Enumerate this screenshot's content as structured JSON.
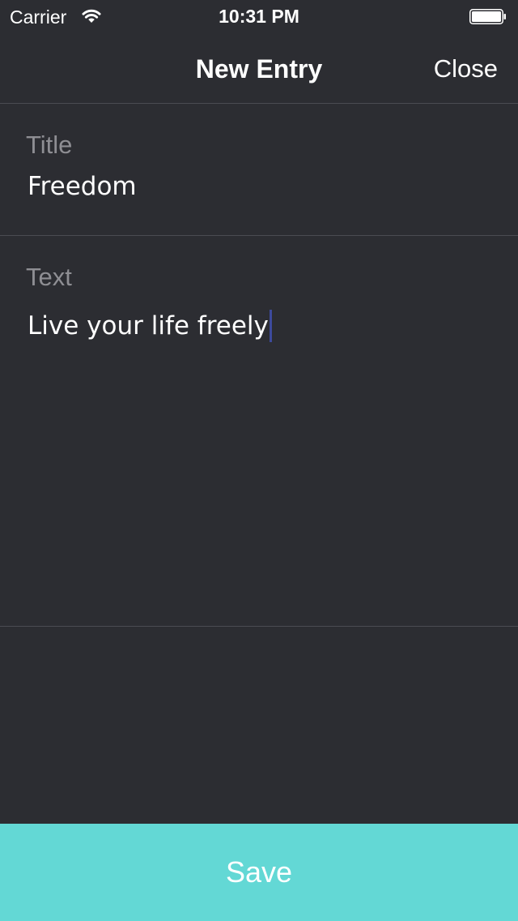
{
  "status_bar": {
    "carrier": "Carrier",
    "time": "10:31 PM",
    "wifi_icon": "wifi-icon",
    "battery_icon": "battery-icon"
  },
  "nav": {
    "title": "New Entry",
    "close_label": "Close"
  },
  "form": {
    "title_label": "Title",
    "title_value": "Freedom",
    "text_label": "Text",
    "text_value": "Live your life freely"
  },
  "actions": {
    "save_label": "Save"
  },
  "colors": {
    "background": "#2c2d32",
    "divider": "#4b4c52",
    "label": "#8e8e93",
    "save_button": "#63d8d5",
    "caret": "#3d4a9c"
  }
}
